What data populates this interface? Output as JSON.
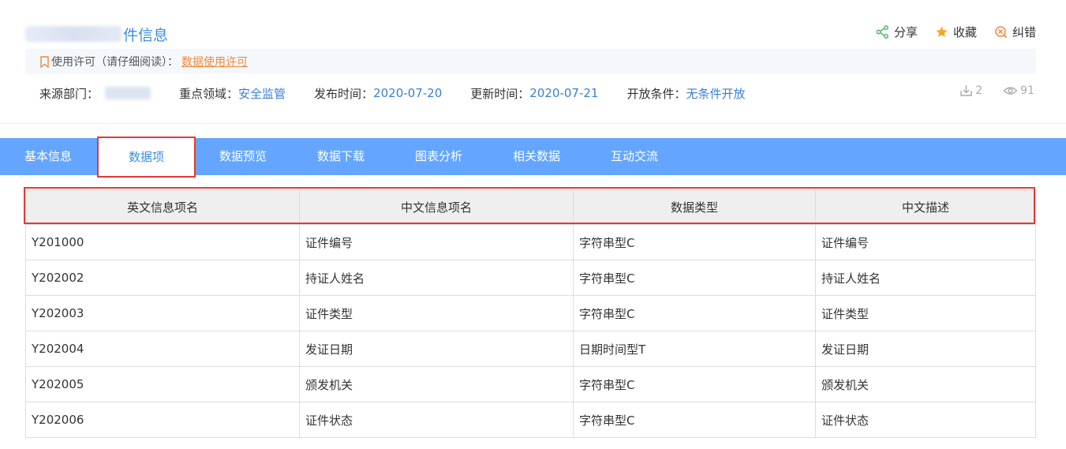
{
  "header": {
    "title_suffix": "件信息",
    "actions": [
      {
        "label": "分享",
        "icon": "share-icon",
        "color": "#4cb86a"
      },
      {
        "label": "收藏",
        "icon": "star-icon",
        "color": "#f5a623"
      },
      {
        "label": "纠错",
        "icon": "error-report-icon",
        "color": "#f0883a"
      }
    ],
    "license": {
      "label": "使用许可（请仔细阅读）：",
      "link": "数据使用许可"
    },
    "meta": {
      "source_label": "来源部门：",
      "domain_label": "重点领域：",
      "domain_value": "安全监管",
      "publish_label": "发布时间：",
      "publish_value": "2020-07-20",
      "update_label": "更新时间：",
      "update_value": "2020-07-21",
      "open_label": "开放条件：",
      "open_value": "无条件开放"
    },
    "stats": {
      "downloads": "2",
      "views": "91"
    }
  },
  "tabs": [
    "基本信息",
    "数据项",
    "数据预览",
    "数据下载",
    "图表分析",
    "相关数据",
    "互动交流"
  ],
  "active_tab_index": 1,
  "table": {
    "columns": [
      "英文信息项名",
      "中文信息项名",
      "数据类型",
      "中文描述"
    ],
    "rows": [
      [
        "Y201000",
        "证件编号",
        "字符串型C",
        "证件编号"
      ],
      [
        "Y202002",
        "持证人姓名",
        "字符串型C",
        "持证人姓名"
      ],
      [
        "Y202003",
        "证件类型",
        "字符串型C",
        "证件类型"
      ],
      [
        "Y202004",
        "发证日期",
        "日期时间型T",
        "发证日期"
      ],
      [
        "Y202005",
        "颁发机关",
        "字符串型C",
        "颁发机关"
      ],
      [
        "Y202006",
        "证件状态",
        "字符串型C",
        "证件状态"
      ]
    ]
  },
  "colors": {
    "accent": "#3a8ee6",
    "tab_bar": "#64a6ff",
    "highlight_border": "#e53935",
    "link_orange": "#f0883a"
  }
}
